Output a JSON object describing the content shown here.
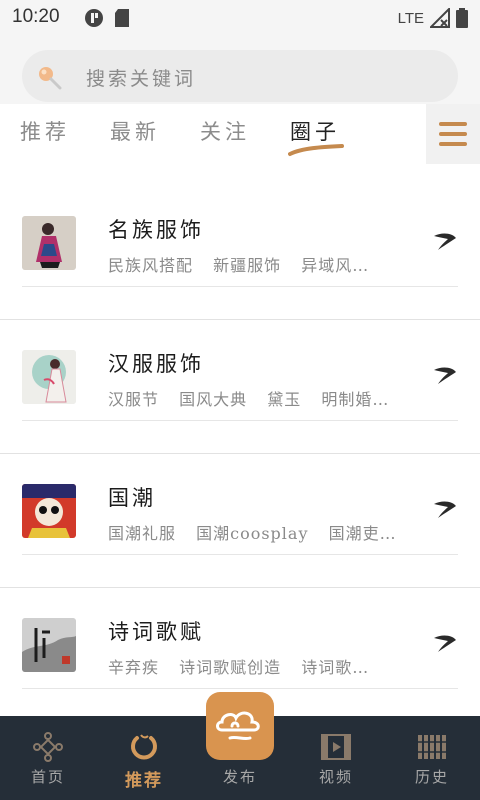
{
  "status_bar": {
    "time": "10:20",
    "network": "LTE"
  },
  "search": {
    "placeholder": "搜索关键词"
  },
  "tabs": [
    {
      "label": "推荐",
      "active": false
    },
    {
      "label": "最新",
      "active": false
    },
    {
      "label": "关注",
      "active": false
    },
    {
      "label": "圈子",
      "active": true
    }
  ],
  "circles": [
    {
      "title": "名族服饰",
      "tags": [
        "民族风搭配",
        "新疆服饰",
        "异域风…"
      ],
      "thumb_icon": "ethnic-costume-image"
    },
    {
      "title": "汉服服饰",
      "tags": [
        "汉服节",
        "国风大典",
        "黛玉",
        "明制婚…"
      ],
      "thumb_icon": "hanfu-image"
    },
    {
      "title": "国潮",
      "tags": [
        "国潮礼服",
        "国潮coosplay",
        "国潮吏…"
      ],
      "thumb_icon": "opera-mask-image"
    },
    {
      "title": "诗词歌赋",
      "tags": [
        "辛弃疾",
        "诗词歌赋创造",
        "诗词歌…"
      ],
      "thumb_icon": "poetry-image"
    }
  ],
  "bottom_nav": {
    "items": [
      {
        "label": "首页",
        "icon": "knot-icon",
        "active": false
      },
      {
        "label": "推荐",
        "icon": "ring-icon",
        "active": true
      },
      {
        "label": "发布",
        "icon": "cloud-icon",
        "active": false
      },
      {
        "label": "视频",
        "icon": "film-icon",
        "active": false
      },
      {
        "label": "历史",
        "icon": "bamboo-slips-icon",
        "active": false
      }
    ]
  },
  "colors": {
    "accent": "#c58a4e",
    "nav_background": "#252e38",
    "publish_button": "#d9944f"
  }
}
